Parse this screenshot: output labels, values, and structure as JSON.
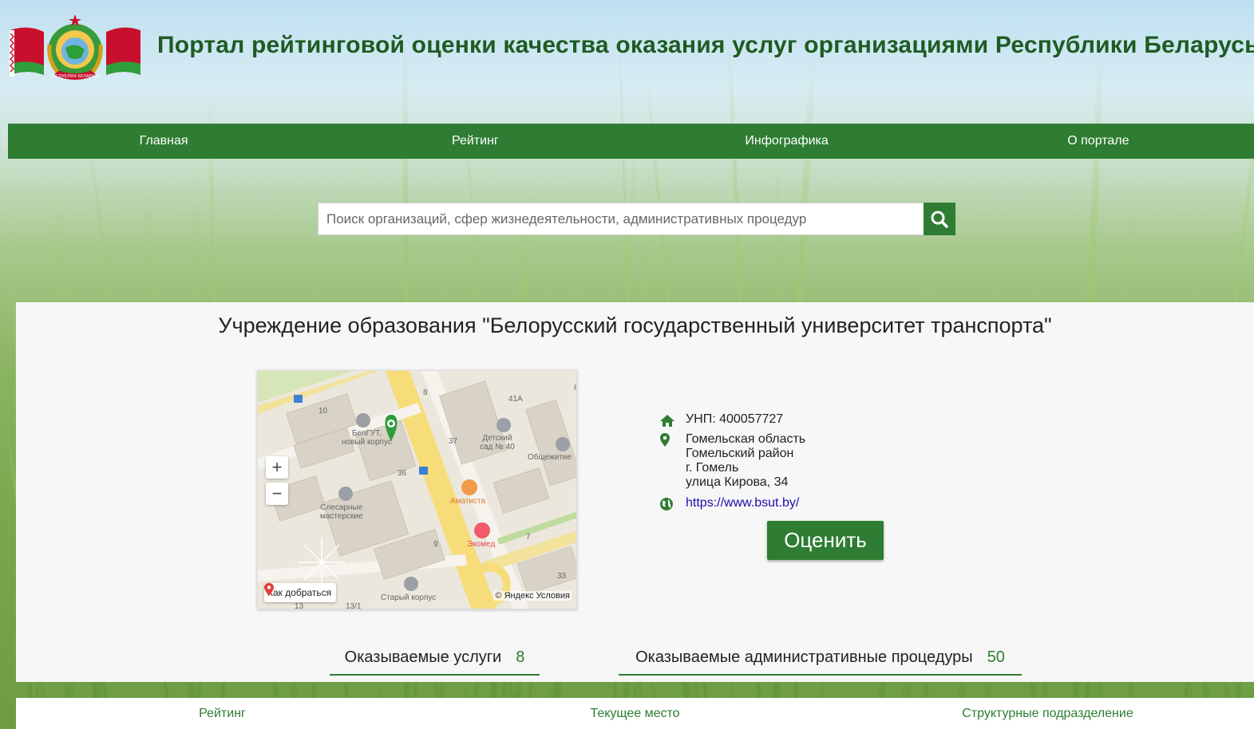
{
  "site_title": "Портал рейтинговой оценки качества оказания услуг организациями Республики Беларусь",
  "emblem_text": "РЭСПУБЛІКА БЕЛАРУСЬ",
  "nav": [
    {
      "label": "Главная"
    },
    {
      "label": "Рейтинг"
    },
    {
      "label": "Инфографика"
    },
    {
      "label": "О портале"
    }
  ],
  "search": {
    "placeholder": "Поиск организаций, сфер жизнедеятельности, административных процедур",
    "value": ""
  },
  "organization": {
    "title": "Учреждение образования \"Белорусский государственный университет транспорта\"",
    "unp": "УНП: 400057727",
    "address": {
      "region": "Гомельская область",
      "district": "Гомельский район",
      "city": "г. Гомель",
      "street": "улица Кирова, 34"
    },
    "website": "https://www.bsut.by/",
    "rate_button": "Оценить"
  },
  "map": {
    "labels": {
      "belgut": "БелГУТ,\nновый корпус",
      "kindergarten": "Детский\nсад № 40",
      "dorm": "Общежитие",
      "workshops": "Слесарные\nмастерские",
      "amatista": "Аматиста",
      "exomed": "Экомед",
      "old_building": "Старый корпус",
      "n10": "10",
      "n8": "8",
      "n41a": "41А",
      "n37": "37",
      "n36": "36",
      "n9": "9",
      "n7": "7",
      "n33": "33",
      "n13": "13",
      "n13_1": "13/1",
      "n6": "6"
    },
    "route_label": "Как добраться",
    "copyright": "© Яндекс",
    "terms": "Условия",
    "zoom_in": "+",
    "zoom_out": "−"
  },
  "stats": [
    {
      "label": "Оказываемые услуги",
      "value": "8"
    },
    {
      "label": "Оказываемые административные процедуры",
      "value": "50"
    }
  ],
  "bottom_tabs": [
    {
      "label": "Рейтинг"
    },
    {
      "label": "Текущее место"
    },
    {
      "label": "Структурные подразделение"
    }
  ],
  "colors": {
    "brand_green": "#2e7d32",
    "title_green": "#1f5b22",
    "link": "#1a0dab"
  }
}
